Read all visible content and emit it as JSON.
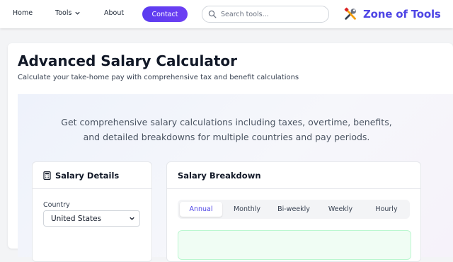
{
  "nav": {
    "home": "Home",
    "tools": "Tools",
    "about": "About",
    "contact": "Contact",
    "search_placeholder": "Search tools...",
    "brand": "Zone of Tools"
  },
  "page": {
    "title": "Advanced Salary Calculator",
    "subtitle": "Calculate your take-home pay with comprehensive tax and benefit calculations",
    "hero_line1": "Get comprehensive salary calculations including taxes, overtime, benefits,",
    "hero_line2": "and detailed breakdowns for multiple countries and pay periods."
  },
  "salary_details": {
    "title": "Salary Details",
    "country_label": "Country",
    "country_value": "United States"
  },
  "breakdown": {
    "title": "Salary Breakdown",
    "tabs": [
      "Annual",
      "Monthly",
      "Bi-weekly",
      "Weekly",
      "Hourly"
    ],
    "active_tab": "Annual"
  },
  "colors": {
    "accent": "#4f46e5",
    "contact_button": "#5b3cf0",
    "result_border": "#bbf7d0"
  }
}
